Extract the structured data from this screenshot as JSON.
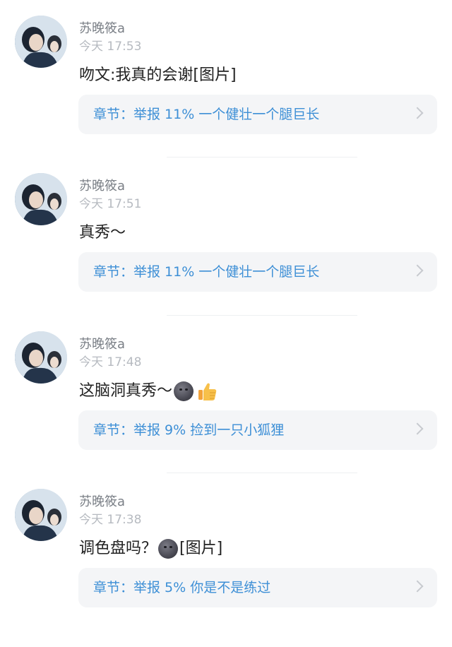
{
  "comments": [
    {
      "username": "苏晚筱a",
      "time": "今天 17:53",
      "text": "吻文:我真的会谢[图片]",
      "emoji": [],
      "chapter": "章节：举报 11% 一个健壮一个腿巨长"
    },
    {
      "username": "苏晚筱a",
      "time": "今天 17:51",
      "text": "真秀～",
      "emoji": [],
      "chapter": "章节：举报 11% 一个健壮一个腿巨长"
    },
    {
      "username": "苏晚筱a",
      "time": "今天 17:48",
      "text": "这脑洞真秀～",
      "emoji": [
        "moon-face-icon",
        "thumbs-up-icon"
      ],
      "chapter": "章节：举报 9% 捡到一只小狐狸"
    },
    {
      "username": "苏晚筱a",
      "time": "今天 17:38",
      "text_before": "调色盘吗？",
      "text_after": "[图片]",
      "emoji": [
        "moon-face-icon"
      ],
      "chapter": "章节：举报 5% 你是不是练过"
    }
  ],
  "colors": {
    "chapter_text": "#3d8fd6",
    "username": "#7a7f86",
    "time": "#b6bac0",
    "card_bg": "#f4f5f7"
  }
}
